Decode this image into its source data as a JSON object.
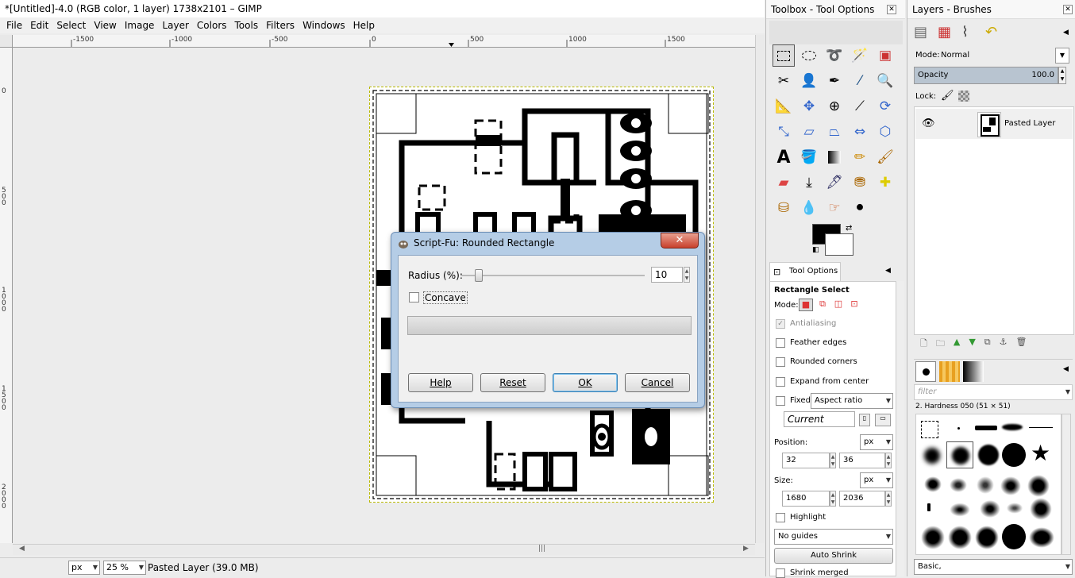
{
  "window": {
    "title": "*[Untitled]-4.0 (RGB color, 1 layer) 1738x2101 – GIMP"
  },
  "menu": [
    "File",
    "Edit",
    "Select",
    "View",
    "Image",
    "Layer",
    "Colors",
    "Tools",
    "Filters",
    "Windows",
    "Help"
  ],
  "ruler": {
    "h_ticks": [
      "-1500",
      "-1000",
      "-500",
      "0",
      "500",
      "1000",
      "1500"
    ],
    "v_ticks": [
      "0",
      "500",
      "1000",
      "1500",
      "2000"
    ]
  },
  "status": {
    "unit": "px",
    "zoom": "25 %",
    "info": "Pasted Layer (39.0 MB)"
  },
  "dialog": {
    "title": "Script-Fu: Rounded Rectangle",
    "radius_label": "Radius (%):",
    "radius_value": "10",
    "radius_fraction": 0.1,
    "concave_label": "Concave",
    "buttons": {
      "help": "Help",
      "reset": "Reset",
      "ok": "OK",
      "cancel": "Cancel"
    }
  },
  "toolbox": {
    "title": "Toolbox - Tool Options",
    "tools": [
      "rect-select",
      "ellipse-select",
      "free-select",
      "fuzzy-select",
      "select-by-color",
      "scissors",
      "foreground-select",
      "paths",
      "color-picker",
      "zoom",
      "measure",
      "move",
      "align",
      "crop",
      "rotate",
      "scale",
      "shear",
      "perspective",
      "flip",
      "cage",
      "text",
      "bucket-fill",
      "blend",
      "pencil",
      "paintbrush",
      "eraser",
      "airbrush",
      "ink",
      "clone",
      "heal",
      "perspective-clone",
      "blur",
      "smudge",
      "dodge-burn"
    ],
    "tool_options_tab": "Tool Options",
    "tool_name": "Rectangle Select",
    "mode_label": "Mode:",
    "antialiasing": "Antialiasing",
    "feather_edges": "Feather edges",
    "rounded_corners": "Rounded corners",
    "expand_from_center": "Expand from center",
    "fixed_label": "Fixed:",
    "fixed_value": "Aspect ratio",
    "current": "Current",
    "position_label": "Position:",
    "position_unit": "px",
    "pos_x": "32",
    "pos_y": "36",
    "size_label": "Size:",
    "size_unit": "px",
    "size_w": "1680",
    "size_h": "2036",
    "highlight": "Highlight",
    "guides": "No guides",
    "auto_shrink": "Auto Shrink",
    "shrink_merged": "Shrink merged",
    "colors": {
      "foreground": "#000000",
      "background": "#ffffff"
    }
  },
  "layers": {
    "title": "Layers - Brushes",
    "mode_label": "Mode:",
    "mode_value": "Normal",
    "opacity_label": "Opacity",
    "opacity_value": "100.0",
    "lock_label": "Lock:",
    "layer_name": "Pasted Layer",
    "brush_filter": "filter",
    "brush_name": "2. Hardness 050 (51 × 51)",
    "brush_set": "Basic,"
  }
}
